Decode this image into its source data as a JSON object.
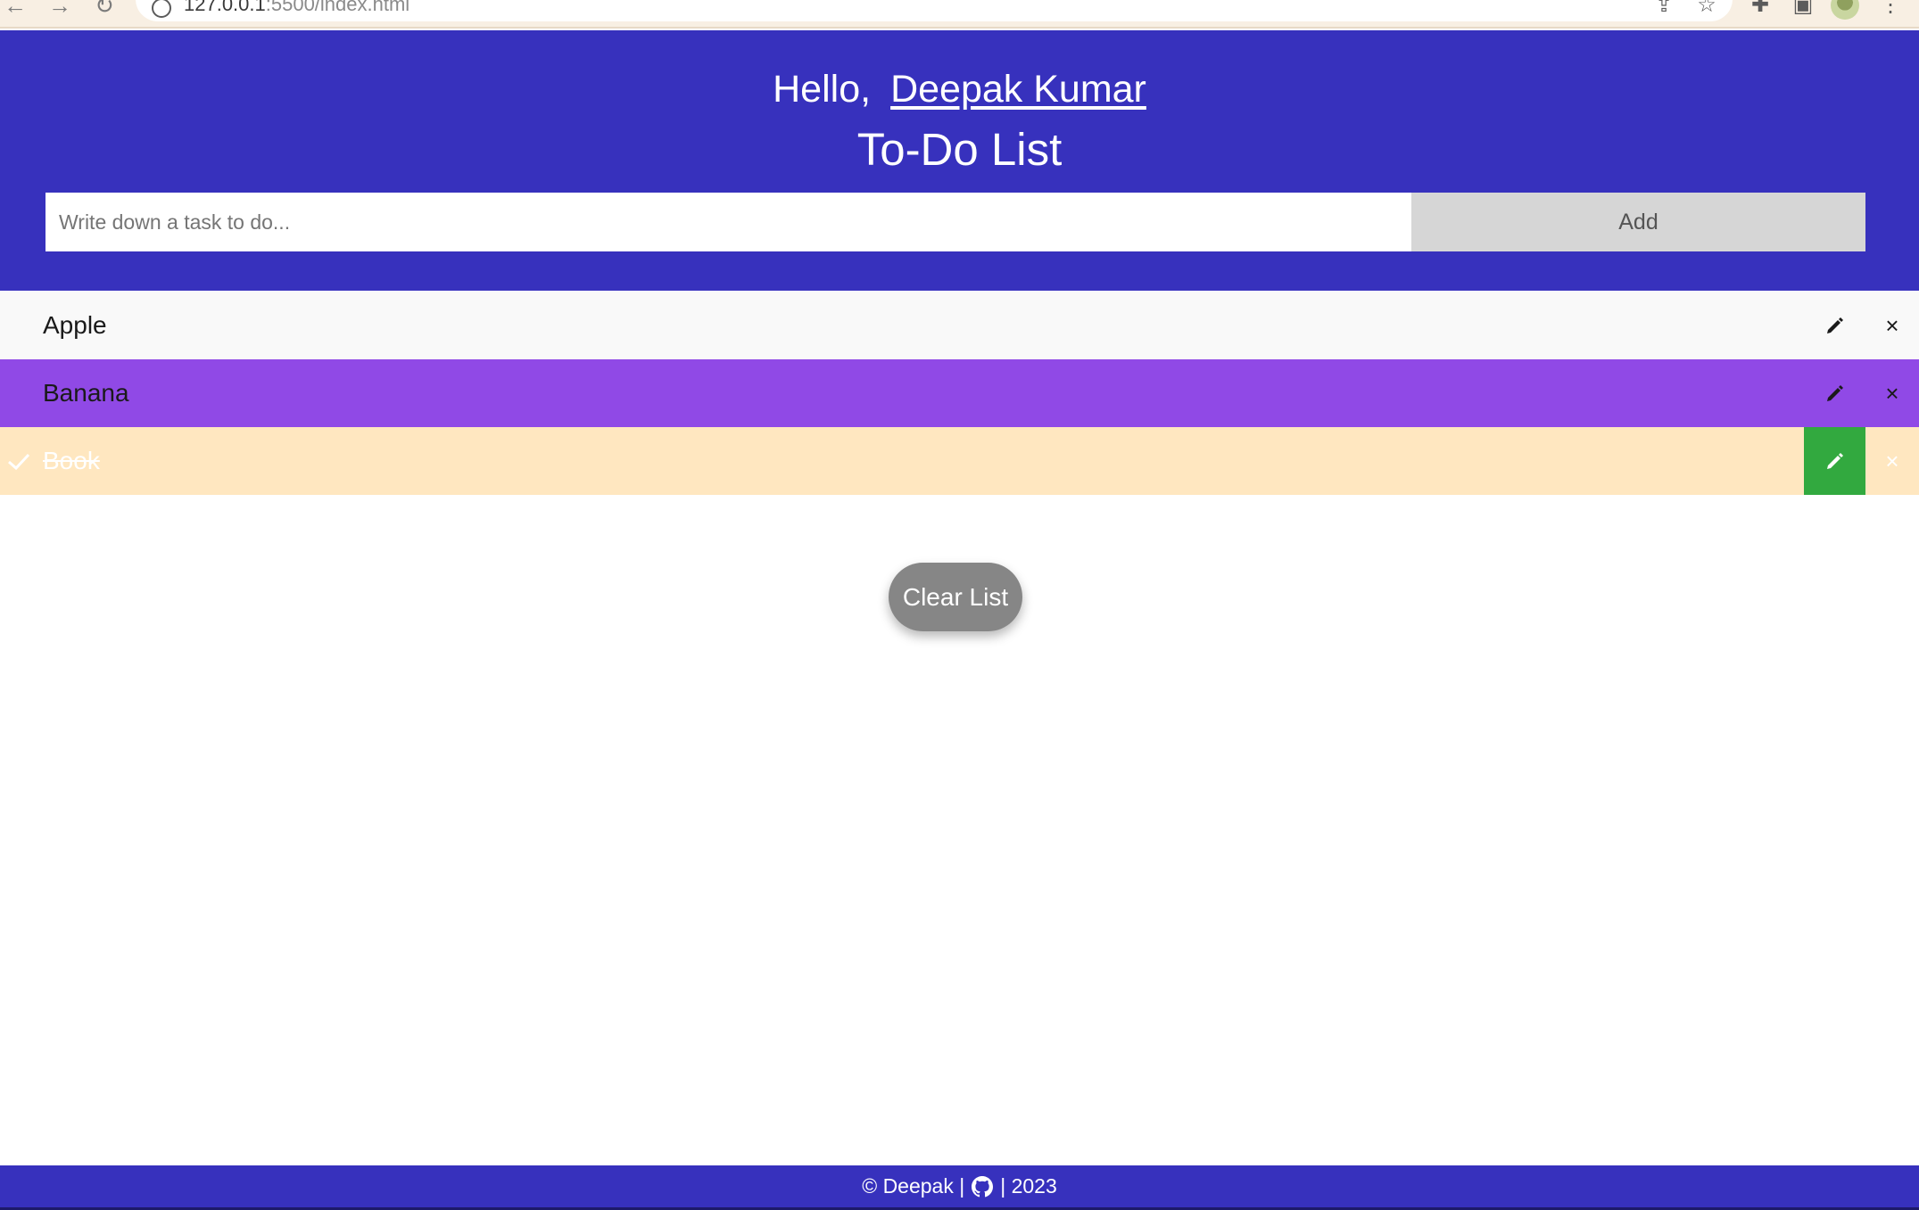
{
  "browser": {
    "url_host": "127.0.0.1",
    "url_rest": ":5500/index.html"
  },
  "header": {
    "greeting": "Hello,",
    "user_name": "Deepak Kumar",
    "title": "To-Do List",
    "background": "#3731bd"
  },
  "input": {
    "placeholder": "Write down a task to do...",
    "value": ""
  },
  "add_button": {
    "label": "Add"
  },
  "tasks": [
    {
      "text": "Apple",
      "completed": false,
      "background": "#f9f9f9"
    },
    {
      "text": "Banana",
      "completed": false,
      "background": "#9049e6"
    },
    {
      "text": "Book",
      "completed": true,
      "background": "#ffe7c0"
    }
  ],
  "icons": {
    "edit": "pencil-icon",
    "delete": "close-icon",
    "done": "check-icon",
    "footer": "github-icon"
  },
  "delete_symbol": "×",
  "clear_button": {
    "label": "Clear List"
  },
  "footer": {
    "copyright": "© Deepak |",
    "year": "| 2023"
  },
  "colors": {
    "accent": "#3731bd",
    "edit_active": "#32a93f",
    "clear_button": "#868686"
  }
}
